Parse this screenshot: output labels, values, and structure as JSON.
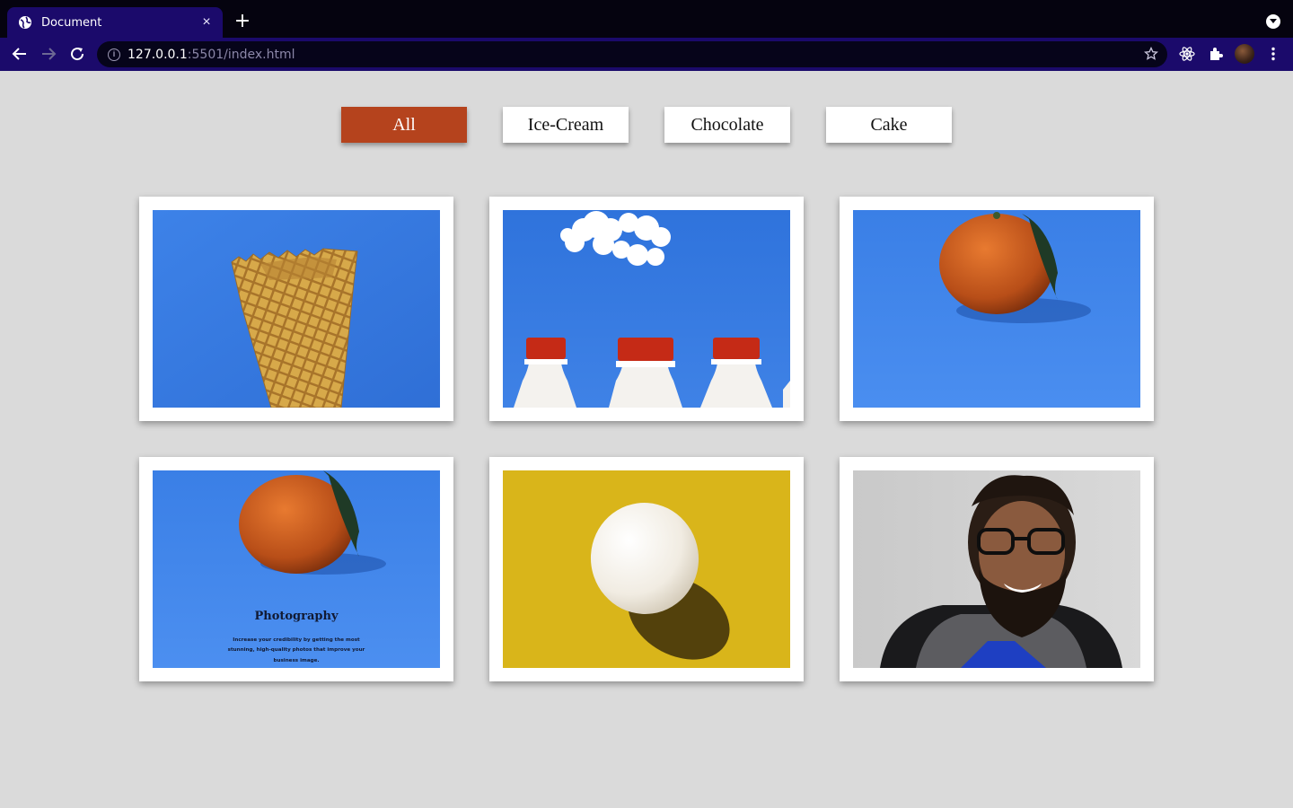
{
  "browser": {
    "tab_title": "Document",
    "tab_close": "×",
    "new_tab": "+",
    "url_host": "127.0.0.1",
    "url_rest": ":5501/index.html",
    "icons": [
      "globe-icon",
      "close-icon",
      "plus-icon",
      "tab-search-icon",
      "back-icon",
      "forward-icon",
      "reload-icon",
      "info-icon",
      "star-icon",
      "react-devtools-icon",
      "extensions-icon",
      "avatar",
      "more-icon"
    ]
  },
  "filters": [
    {
      "label": "All",
      "active": true
    },
    {
      "label": "Ice-Cream",
      "active": false
    },
    {
      "label": "Chocolate",
      "active": false
    },
    {
      "label": "Cake",
      "active": false
    }
  ],
  "gallery": [
    {
      "subject": "waffle cone on blue background"
    },
    {
      "subject": "milk bottles under a cloud"
    },
    {
      "subject": "tangerine on blue background"
    },
    {
      "subject": "tangerine poster",
      "heading": "Photography",
      "text_lines": [
        "Increase your credibility by getting the most",
        "stunning, high-quality photos that improve your",
        "business image."
      ]
    },
    {
      "subject": "egg on yellow background"
    },
    {
      "subject": "smiling bearded man with glasses"
    }
  ],
  "colors": {
    "page_bg": "#dadada",
    "accent": "#b5431d",
    "chrome_dark": "#05030f",
    "chrome_purple": "#1b0a6b"
  }
}
